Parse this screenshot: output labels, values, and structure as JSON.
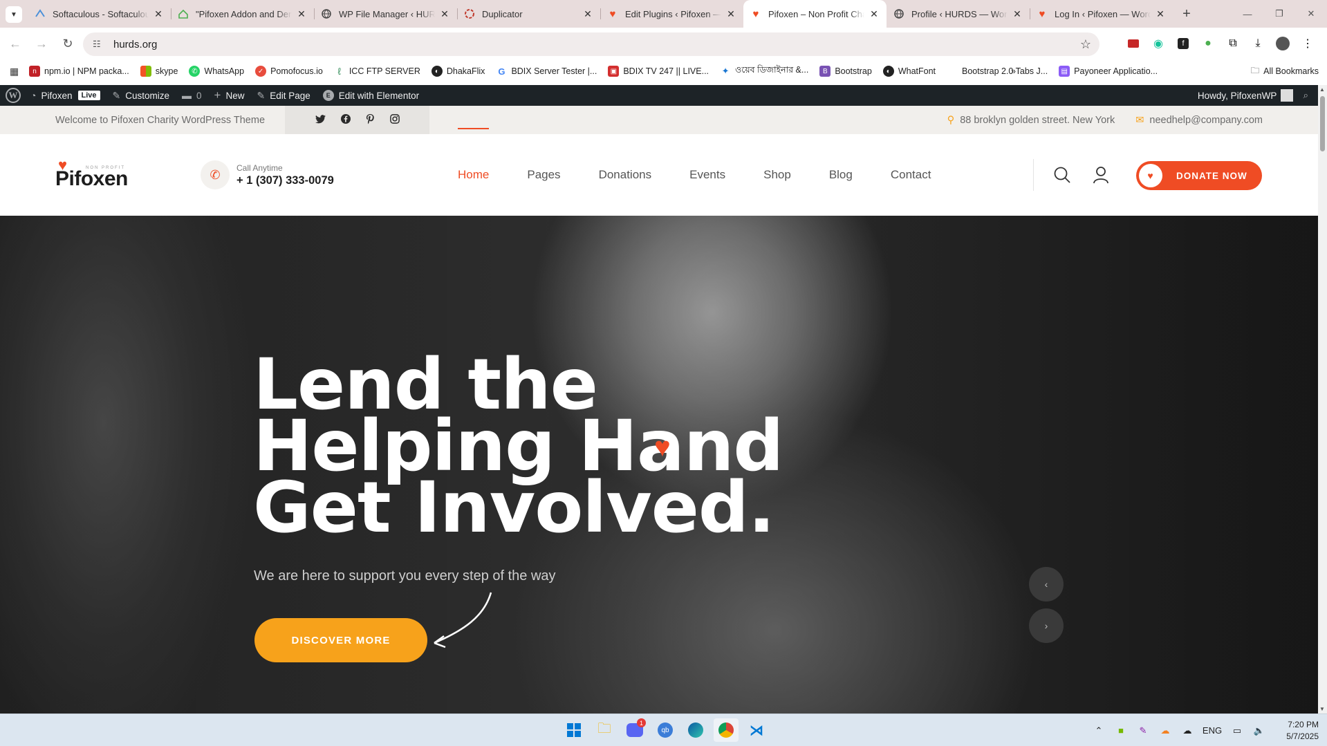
{
  "browser": {
    "tabs": [
      {
        "title": "Softaculous - Softaculous",
        "icon": "softaculous-icon",
        "active": false
      },
      {
        "title": "\"Pifoxen Addon and Demo",
        "icon": "wp-house-icon",
        "active": false
      },
      {
        "title": "WP File Manager ‹ HURDS",
        "icon": "globe-icon",
        "active": false
      },
      {
        "title": "Duplicator",
        "icon": "duplicator-icon",
        "active": false
      },
      {
        "title": "Edit Plugins ‹ Pifoxen — W",
        "icon": "heart-icon",
        "active": false
      },
      {
        "title": "Pifoxen – Non Profit Char",
        "icon": "heart-icon",
        "active": true
      },
      {
        "title": "Profile ‹ HURDS — WordP",
        "icon": "globe-icon",
        "active": false
      },
      {
        "title": "Log In ‹ Pifoxen — WordP",
        "icon": "heart-icon",
        "active": false
      }
    ],
    "url": "hurds.org",
    "bookmarks": [
      {
        "label": "npm.io | NPM packa...",
        "color": "#c12127"
      },
      {
        "label": "skype",
        "color": "#0078d4"
      },
      {
        "label": "WhatsApp",
        "color": "#25d366"
      },
      {
        "label": "Pomofocus.io",
        "color": "#e84c3d"
      },
      {
        "label": "ICC FTP SERVER",
        "color": "#2e8b57"
      },
      {
        "label": "DhakaFlix",
        "color": "#222222"
      },
      {
        "label": "BDIX Server Tester |...",
        "color": "#4285f4"
      },
      {
        "label": "BDIX TV 247 || LIVE...",
        "color": "#d32f2f"
      },
      {
        "label": "ওয়েব ডিজাইনার &...",
        "color": "#1976d2"
      },
      {
        "label": "Bootstrap",
        "color": "#7952b3"
      },
      {
        "label": "WhatFont",
        "color": "#222222"
      },
      {
        "label": "Bootstrap 2.0 Tabs J...",
        "color": "#ffffff"
      },
      {
        "label": "Payoneer Applicatio...",
        "color": "#8b5cf6"
      }
    ],
    "all_bookmarks": "All Bookmarks"
  },
  "wpbar": {
    "site": "Pifoxen",
    "live": "Live",
    "customize": "Customize",
    "comments": "0",
    "new": "New",
    "edit_page": "Edit Page",
    "edit_elementor": "Edit with Elementor",
    "howdy": "Howdy, PifoxenWP"
  },
  "topbar": {
    "welcome": "Welcome to Pifoxen Charity WordPress Theme",
    "address": "88 broklyn golden street. New York",
    "email": "needhelp@company.com"
  },
  "header": {
    "logo_name": "Pifoxen",
    "logo_tag": "NON PROFIT",
    "call_label": "Call Anytime",
    "call_number": "+ 1 (307) 333-0079",
    "nav": [
      "Home",
      "Pages",
      "Donations",
      "Events",
      "Shop",
      "Blog",
      "Contact"
    ],
    "donate": "DONATE NOW"
  },
  "hero": {
    "line1": "Lend the",
    "line2": "Helping Hand",
    "line3": "Get Involved.",
    "subtitle": "We are here to support you every step of the way",
    "cta": "DISCOVER MORE"
  },
  "taskbar": {
    "lang": "ENG",
    "time": "7:20 PM",
    "date": "5/7/2025",
    "discord_badge": "1"
  },
  "colors": {
    "accent": "#ef4c24",
    "cta": "#f7a21b",
    "wpbar": "#1d2327"
  }
}
